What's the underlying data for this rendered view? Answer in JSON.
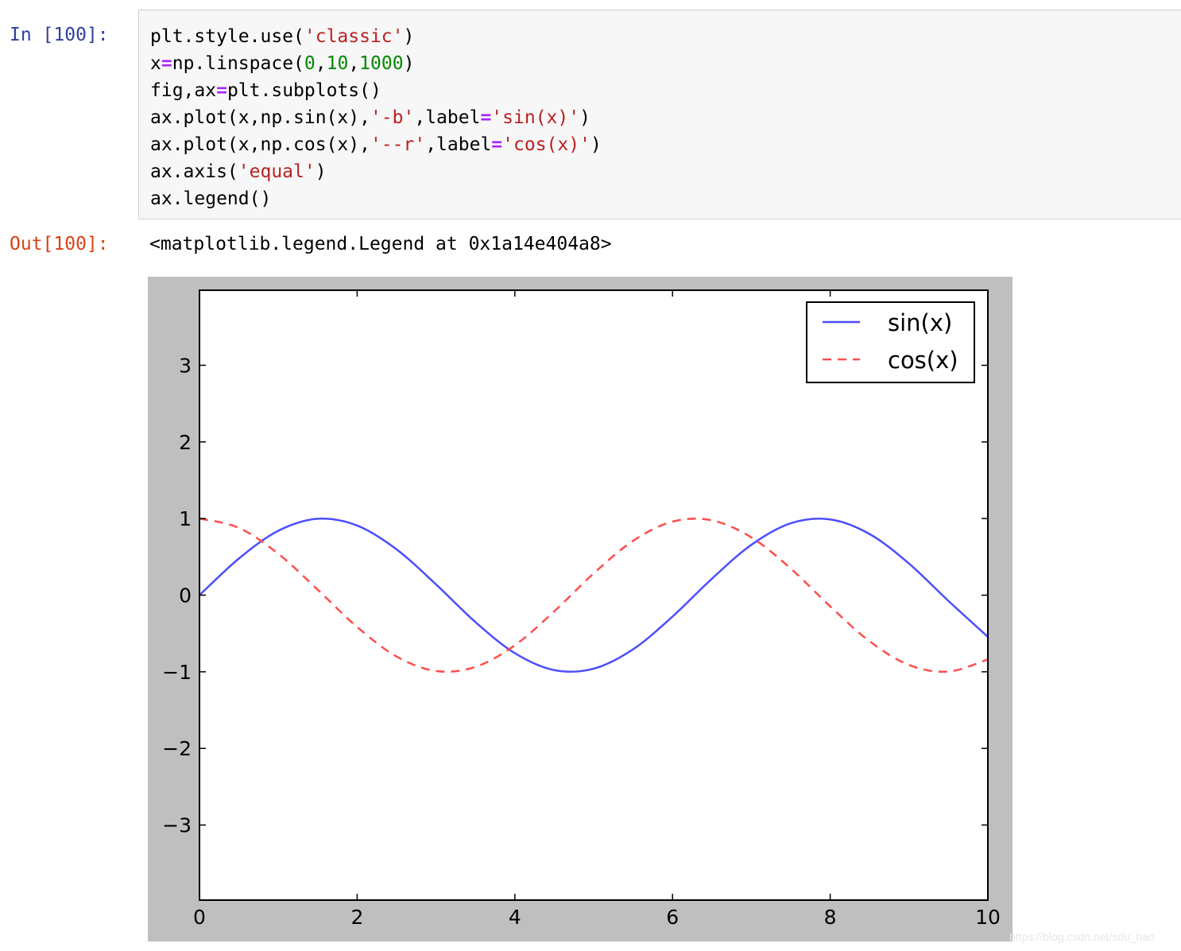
{
  "cell": {
    "in_prompt": "In [100]:",
    "out_prompt": "Out[100]:",
    "code_lines": [
      [
        {
          "t": "plt.style.use("
        },
        {
          "t": "'classic'",
          "c": "str"
        },
        {
          "t": ")"
        }
      ],
      [
        {
          "t": "x"
        },
        {
          "t": "=",
          "c": "op"
        },
        {
          "t": "np.linspace("
        },
        {
          "t": "0",
          "c": "num"
        },
        {
          "t": ","
        },
        {
          "t": "10",
          "c": "num"
        },
        {
          "t": ","
        },
        {
          "t": "1000",
          "c": "num"
        },
        {
          "t": ")"
        }
      ],
      [
        {
          "t": "fig,ax"
        },
        {
          "t": "=",
          "c": "op"
        },
        {
          "t": "plt.subplots()"
        }
      ],
      [
        {
          "t": "ax.plot(x,np.sin(x),"
        },
        {
          "t": "'-b'",
          "c": "str"
        },
        {
          "t": ",label"
        },
        {
          "t": "=",
          "c": "op"
        },
        {
          "t": "'sin(x)'",
          "c": "str"
        },
        {
          "t": ")"
        }
      ],
      [
        {
          "t": "ax.plot(x,np.cos(x),"
        },
        {
          "t": "'--r'",
          "c": "str"
        },
        {
          "t": ",label"
        },
        {
          "t": "=",
          "c": "op"
        },
        {
          "t": "'cos(x)'",
          "c": "str"
        },
        {
          "t": ")"
        }
      ],
      [
        {
          "t": "ax.axis("
        },
        {
          "t": "'equal'",
          "c": "str"
        },
        {
          "t": ")"
        }
      ],
      [
        {
          "t": "ax.legend()"
        }
      ]
    ],
    "output_text": "<matplotlib.legend.Legend at 0x1a14e404a8>"
  },
  "colors": {
    "in_prompt": "#303f9f",
    "out_prompt": "#d84315",
    "string": "#ba2121",
    "number": "#008800",
    "operator": "#aa22ff",
    "figure_background": "#bfbfbf",
    "sin_line": "#4d4dff",
    "cos_line": "#ff4d4d"
  },
  "chart_data": {
    "type": "line",
    "xlim": [
      0,
      10
    ],
    "ylim": [
      -3.98,
      3.98
    ],
    "xticks": [
      0,
      2,
      4,
      6,
      8,
      10
    ],
    "xtick_labels": [
      "0",
      "2",
      "4",
      "6",
      "8",
      "10"
    ],
    "yticks": [
      3,
      2,
      1,
      0,
      -1,
      -2,
      -3
    ],
    "ytick_labels": [
      "3",
      "2",
      "1",
      "0",
      "−1",
      "−2",
      "−3"
    ],
    "grid": false,
    "legend_position": "top-right",
    "series": [
      {
        "name": "sin(x)",
        "style": "solid",
        "color": "#4d4dff",
        "x": [
          0,
          0.5,
          1,
          1.5,
          2,
          2.5,
          3,
          3.5,
          4,
          4.5,
          5,
          5.5,
          6,
          6.5,
          7,
          7.5,
          8,
          8.5,
          9,
          9.5,
          10
        ],
        "y": [
          0,
          0.479,
          0.841,
          0.997,
          0.909,
          0.598,
          0.141,
          -0.351,
          -0.757,
          -0.978,
          -0.959,
          -0.706,
          -0.279,
          0.215,
          0.657,
          0.938,
          0.989,
          0.798,
          0.412,
          -0.075,
          -0.544
        ]
      },
      {
        "name": "cos(x)",
        "style": "dashed",
        "color": "#ff4d4d",
        "x": [
          0,
          0.5,
          1,
          1.5,
          2,
          2.5,
          3,
          3.5,
          4,
          4.5,
          5,
          5.5,
          6,
          6.5,
          7,
          7.5,
          8,
          8.5,
          9,
          9.5,
          10
        ],
        "y": [
          1,
          0.878,
          0.54,
          0.071,
          -0.416,
          -0.801,
          -0.99,
          -0.936,
          -0.654,
          -0.211,
          0.284,
          0.709,
          0.96,
          0.977,
          0.754,
          0.347,
          -0.146,
          -0.602,
          -0.911,
          -0.997,
          -0.839
        ]
      }
    ]
  },
  "watermark": "https://blog.csdn.net/sdu_hao"
}
